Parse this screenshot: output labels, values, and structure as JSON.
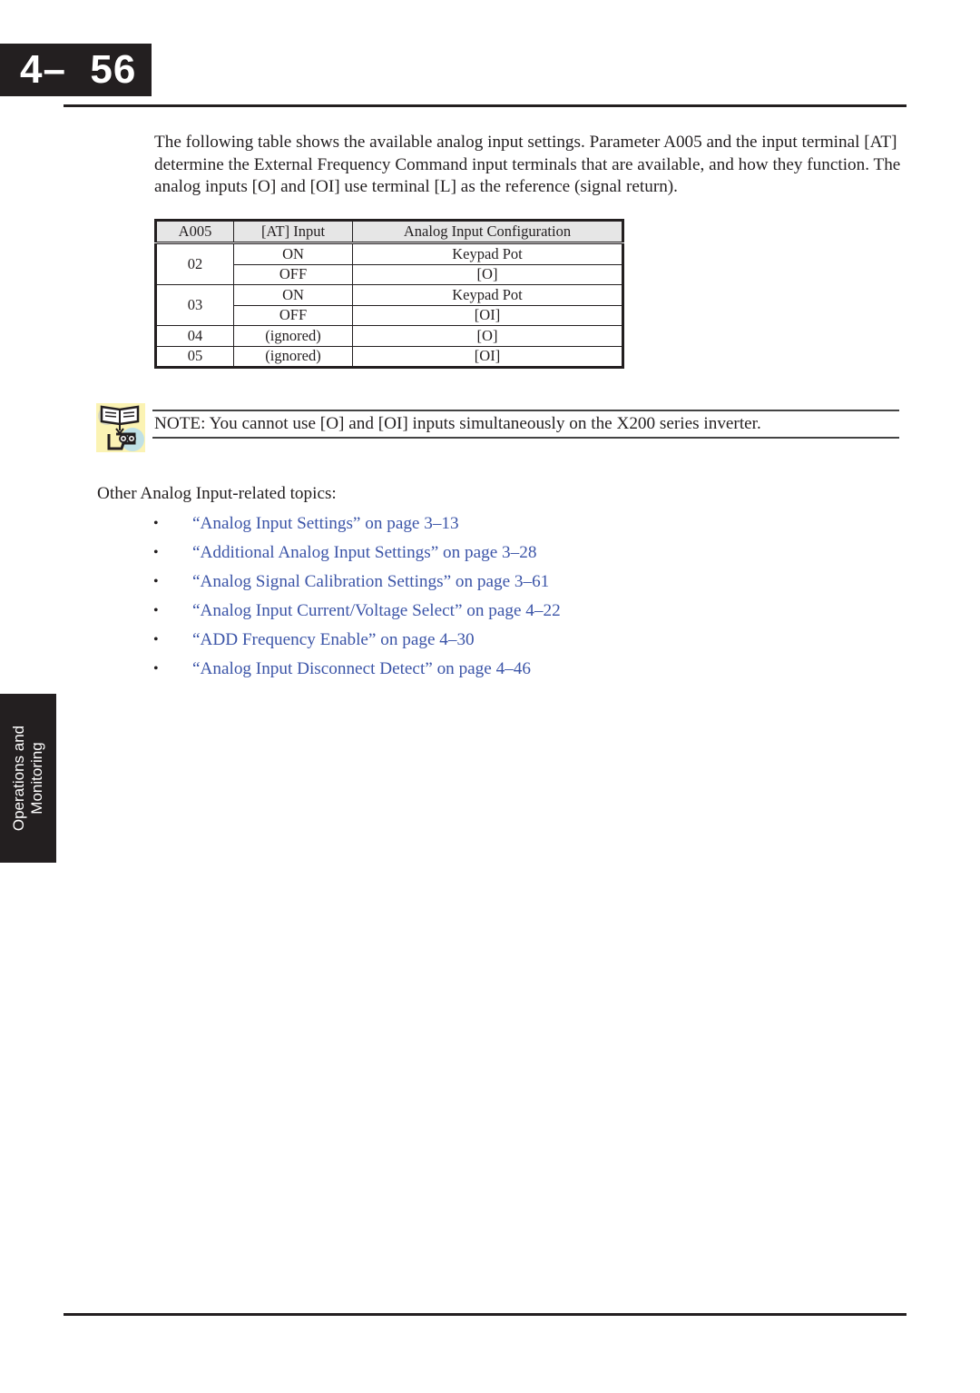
{
  "header": {
    "page_number": "4–  56"
  },
  "intro_paragraph": "The following table shows the available analog input settings. Parameter A005 and the input terminal [AT] determine the External Frequency Command input terminals that are available, and how they function. The analog inputs [O] and [OI] use terminal [L] as the reference (signal return).",
  "table": {
    "headers": [
      "A005",
      "[AT] Input",
      "Analog Input Configuration"
    ],
    "rows": [
      {
        "a005": "02",
        "at_input": "ON",
        "config": "Keypad Pot"
      },
      {
        "a005": "02",
        "at_input": "OFF",
        "config": "[O]"
      },
      {
        "a005": "03",
        "at_input": "ON",
        "config": "Keypad Pot"
      },
      {
        "a005": "03",
        "at_input": "OFF",
        "config": "[OI]"
      },
      {
        "a005": "04",
        "at_input": "(ignored)",
        "config": "[O]"
      },
      {
        "a005": "05",
        "at_input": "(ignored)",
        "config": "[OI]"
      }
    ]
  },
  "note": {
    "icon": "book-reader-icon",
    "label": "NOTE",
    "text": ": You cannot use [O] and [OI] inputs simultaneously on the X200 series inverter."
  },
  "topics": {
    "heading": "Other Analog Input-related topics:",
    "bullet": "•",
    "items": [
      "“Analog Input Settings” on page 3–13",
      "“Additional Analog Input Settings” on page 3–28",
      "“Analog Signal Calibration Settings” on page 3–61",
      "“Analog Input Current/Voltage Select” on page 4–22",
      "“ADD Frequency Enable” on page 4–30",
      "“Analog Input Disconnect Detect” on page 4–46"
    ]
  },
  "side_tab": {
    "line1": "Operations and",
    "line2": "Monitoring"
  },
  "colors": {
    "link": "#3c55a8",
    "ink": "#231f20",
    "table_header_bg": "#e6e6e6"
  }
}
